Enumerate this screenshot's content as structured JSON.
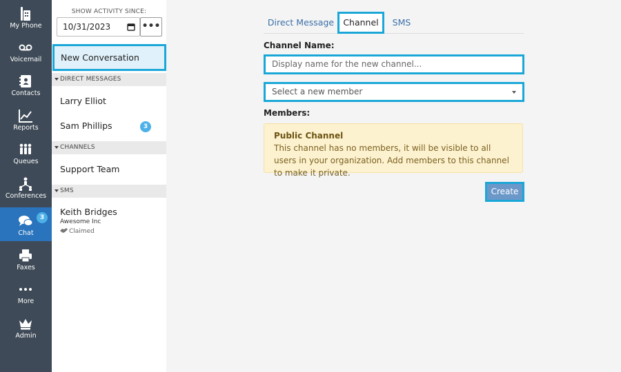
{
  "nav": {
    "items": [
      {
        "label": "My Phone",
        "icon": "phone-icon"
      },
      {
        "label": "Voicemail",
        "icon": "voicemail-icon"
      },
      {
        "label": "Contacts",
        "icon": "contacts-icon"
      },
      {
        "label": "Reports",
        "icon": "reports-icon"
      },
      {
        "label": "Queues",
        "icon": "queues-icon"
      },
      {
        "label": "Conferences",
        "icon": "conferences-icon"
      },
      {
        "label": "Chat",
        "icon": "chat-icon",
        "badge": "3",
        "active": true
      },
      {
        "label": "Faxes",
        "icon": "fax-icon"
      },
      {
        "label": "More",
        "icon": "more-dots-icon"
      },
      {
        "label": "Admin",
        "icon": "crown-icon"
      }
    ]
  },
  "sidebar": {
    "since_label": "SHOW ACTIVITY SINCE:",
    "date_value": "10/31/2023",
    "more_button": "•••",
    "new_conversation": "New Conversation",
    "sections": {
      "direct_messages": {
        "title": "DIRECT MESSAGES",
        "items": [
          {
            "name": "Larry Elliot"
          },
          {
            "name": "Sam Phillips",
            "badge": "3"
          }
        ]
      },
      "channels": {
        "title": "CHANNELS",
        "items": [
          {
            "name": "Support Team"
          }
        ]
      },
      "sms": {
        "title": "SMS",
        "items": [
          {
            "name": "Keith Bridges",
            "company": "Awesome Inc",
            "status": "Claimed"
          }
        ]
      }
    }
  },
  "main": {
    "tabs": [
      {
        "label": "Direct Message"
      },
      {
        "label": "Channel",
        "active": true
      },
      {
        "label": "SMS"
      }
    ],
    "channel_name_label": "Channel Name:",
    "channel_name_placeholder": "Display name for the new channel...",
    "member_select": "Select a new member",
    "members_label": "Members:",
    "notice": {
      "title": "Public Channel",
      "body": "This channel has no members, it will be visible to all users in your organization. Add members to this channel to make it private."
    },
    "create_button": "Create"
  },
  "colors": {
    "nav_bg": "#3e4a57",
    "nav_active": "#2a74bd",
    "focus_outline": "#1aa7d8",
    "badge": "#4db1e8",
    "notice_bg": "#fdf2cf",
    "create_button": "#6b98c9"
  }
}
